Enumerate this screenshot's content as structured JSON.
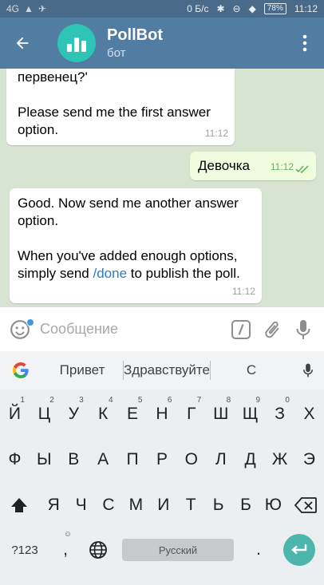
{
  "status_bar": {
    "network": "4G",
    "speed": "0 Б/с",
    "battery": "78%",
    "time": "11:12"
  },
  "header": {
    "title": "PollBot",
    "subtitle": "бот",
    "icons": [
      "back-arrow-icon",
      "bot-bar-chart-avatar",
      "more-vertical-icon"
    ]
  },
  "messages": [
    {
      "direction": "in",
      "lines": [
        "первенец?'"
      ],
      "text": "Please send me the first answer option.",
      "time": "11:12"
    },
    {
      "direction": "out",
      "text": "Девочка",
      "time": "11:12"
    },
    {
      "direction": "in",
      "text1": "Good. Now send me another answer option.",
      "text2_before": "When you've added enough options, simply send ",
      "text2_link": "/done",
      "text2_after": " to publish the poll.",
      "time": "11:12"
    }
  ],
  "composer": {
    "placeholder": "Сообщение",
    "icons": [
      "emoji-icon",
      "bot-command-icon",
      "attach-icon",
      "mic-icon"
    ]
  },
  "keyboard": {
    "suggestions": [
      "Привет",
      "Здравствуйте",
      "С"
    ],
    "row1": [
      {
        "k": "Й",
        "h": "1"
      },
      {
        "k": "Ц",
        "h": "2"
      },
      {
        "k": "У",
        "h": "3"
      },
      {
        "k": "К",
        "h": "4"
      },
      {
        "k": "Е",
        "h": "5"
      },
      {
        "k": "Н",
        "h": "6"
      },
      {
        "k": "Г",
        "h": "7"
      },
      {
        "k": "Ш",
        "h": "8"
      },
      {
        "k": "Щ",
        "h": "9"
      },
      {
        "k": "З",
        "h": "0"
      },
      {
        "k": "Х",
        "h": ""
      }
    ],
    "row2": [
      "Ф",
      "Ы",
      "В",
      "А",
      "П",
      "Р",
      "О",
      "Л",
      "Д",
      "Ж",
      "Э"
    ],
    "row3": [
      "Я",
      "Ч",
      "С",
      "М",
      "И",
      "Т",
      "Ь",
      "Б",
      "Ю"
    ],
    "symbols_key": "?123",
    "comma_key": ",",
    "space_label": "Русский",
    "period_key": ".",
    "colors": {
      "enter": "#4db6ac",
      "header": "#527da3",
      "avatar": "#2ec4b6"
    }
  }
}
